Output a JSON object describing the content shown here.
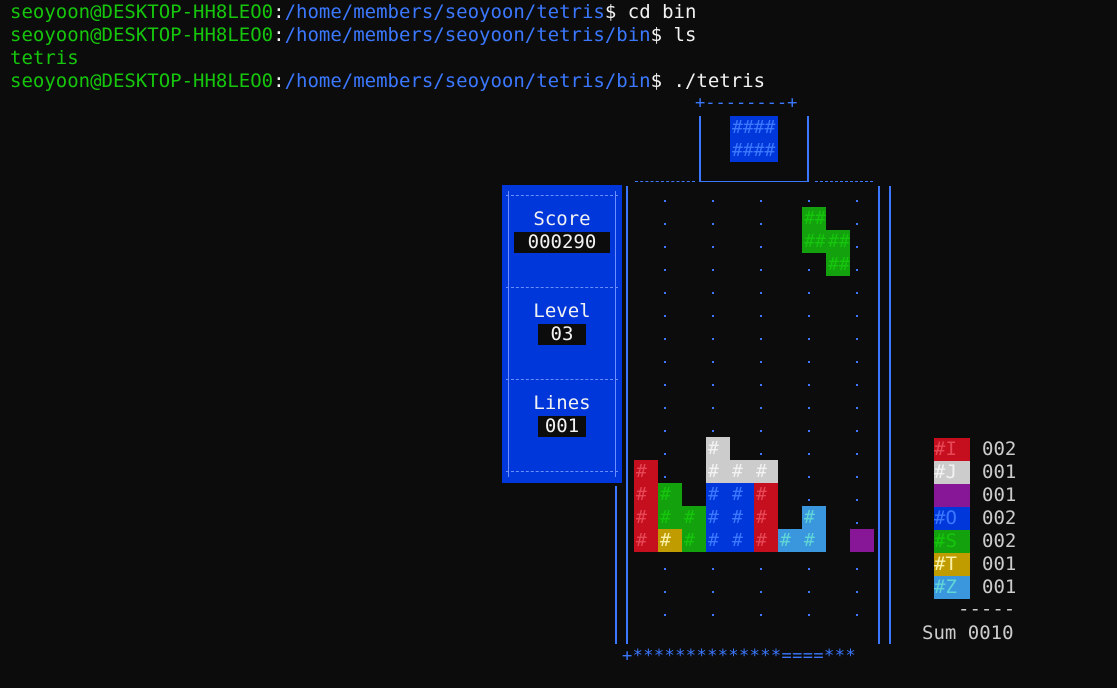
{
  "terminal": {
    "user_host": "seoyoon@DESKTOP-HH8LEO0",
    "lines": [
      {
        "path": "/home/members/seoyoon/tetris",
        "symbol": "$",
        "command": "cd bin"
      },
      {
        "path": "/home/members/seoyoon/tetris/bin",
        "symbol": "$",
        "command": "ls"
      },
      {
        "path": "/home/members/seoyoon/tetris/bin",
        "symbol": "$",
        "command": "./tetris"
      }
    ],
    "ls_output": "tetris"
  },
  "next_piece": {
    "frame_top": "+--------+",
    "cells": "####"
  },
  "stats": {
    "score_label": "Score",
    "score_value": "000290",
    "level_label": "Level",
    "level_value": "03",
    "lines_label": "Lines",
    "lines_value": "001"
  },
  "board": {
    "floor": "+**************====***"
  },
  "legend": {
    "rows": [
      {
        "label": "#I",
        "count": "002",
        "color": "#c50f1f"
      },
      {
        "label": "#J",
        "count": "001",
        "color": "#cccccc"
      },
      {
        "label": "",
        "count": "001",
        "color": "#881798"
      },
      {
        "label": "#O",
        "count": "002",
        "color": "#0037da"
      },
      {
        "label": "#S",
        "count": "002",
        "color": "#13a10e"
      },
      {
        "label": "#T",
        "count": "001",
        "color": "#c19c00"
      },
      {
        "label": "#Z",
        "count": "001",
        "color": "#3a96dd"
      }
    ],
    "divider": "-----",
    "sum_label": "Sum",
    "sum_value": "0010"
  },
  "colors": {
    "prompt_user": "#16c60c",
    "prompt_path": "#3b78ff",
    "background": "#0c0c0c",
    "panel": "#0037da"
  }
}
